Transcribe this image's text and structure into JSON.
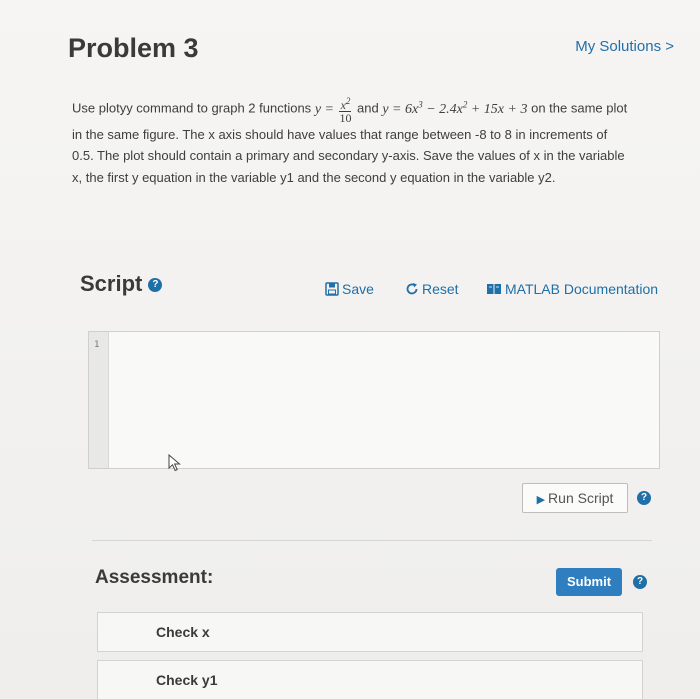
{
  "header": {
    "title": "Problem 3",
    "my_solutions": "My Solutions >"
  },
  "problem": {
    "intro": "Use plotyy command to graph 2 functions",
    "eq1_y": "y =",
    "eq1_num": "x",
    "eq1_num_exp": "2",
    "eq1_den": "10",
    "and": "and",
    "eq2_a": "y = 6x",
    "eq2_exp1": "3",
    "eq2_b": " − 2.4x",
    "eq2_exp2": "2",
    "eq2_c": " + 15x + 3",
    "on_the": "on the",
    "body": "same plot in the same figure. The x axis should have values that range between -8 to 8 in increments of 0.5. The plot should contain a primary and secondary y-axis. Save the values of x in the variable x, the first y equation in the variable y1 and the second y equation in the variable y2."
  },
  "script": {
    "heading": "Script",
    "help_icon": "question-circle-icon",
    "save_label": "Save",
    "save_icon": "floppy-disk-icon",
    "reset_label": "Reset",
    "reset_icon": "refresh-icon",
    "docs_label": "MATLAB Documentation",
    "docs_icon": "book-icon",
    "line_number": "1",
    "run_label": "Run Script",
    "run_icon": "play-icon"
  },
  "assessment": {
    "heading": "Assessment:",
    "submit_label": "Submit",
    "checks": [
      "Check x",
      "Check y1"
    ]
  },
  "colors": {
    "accent": "#1f6fa8",
    "submit": "#2f7fc0"
  }
}
